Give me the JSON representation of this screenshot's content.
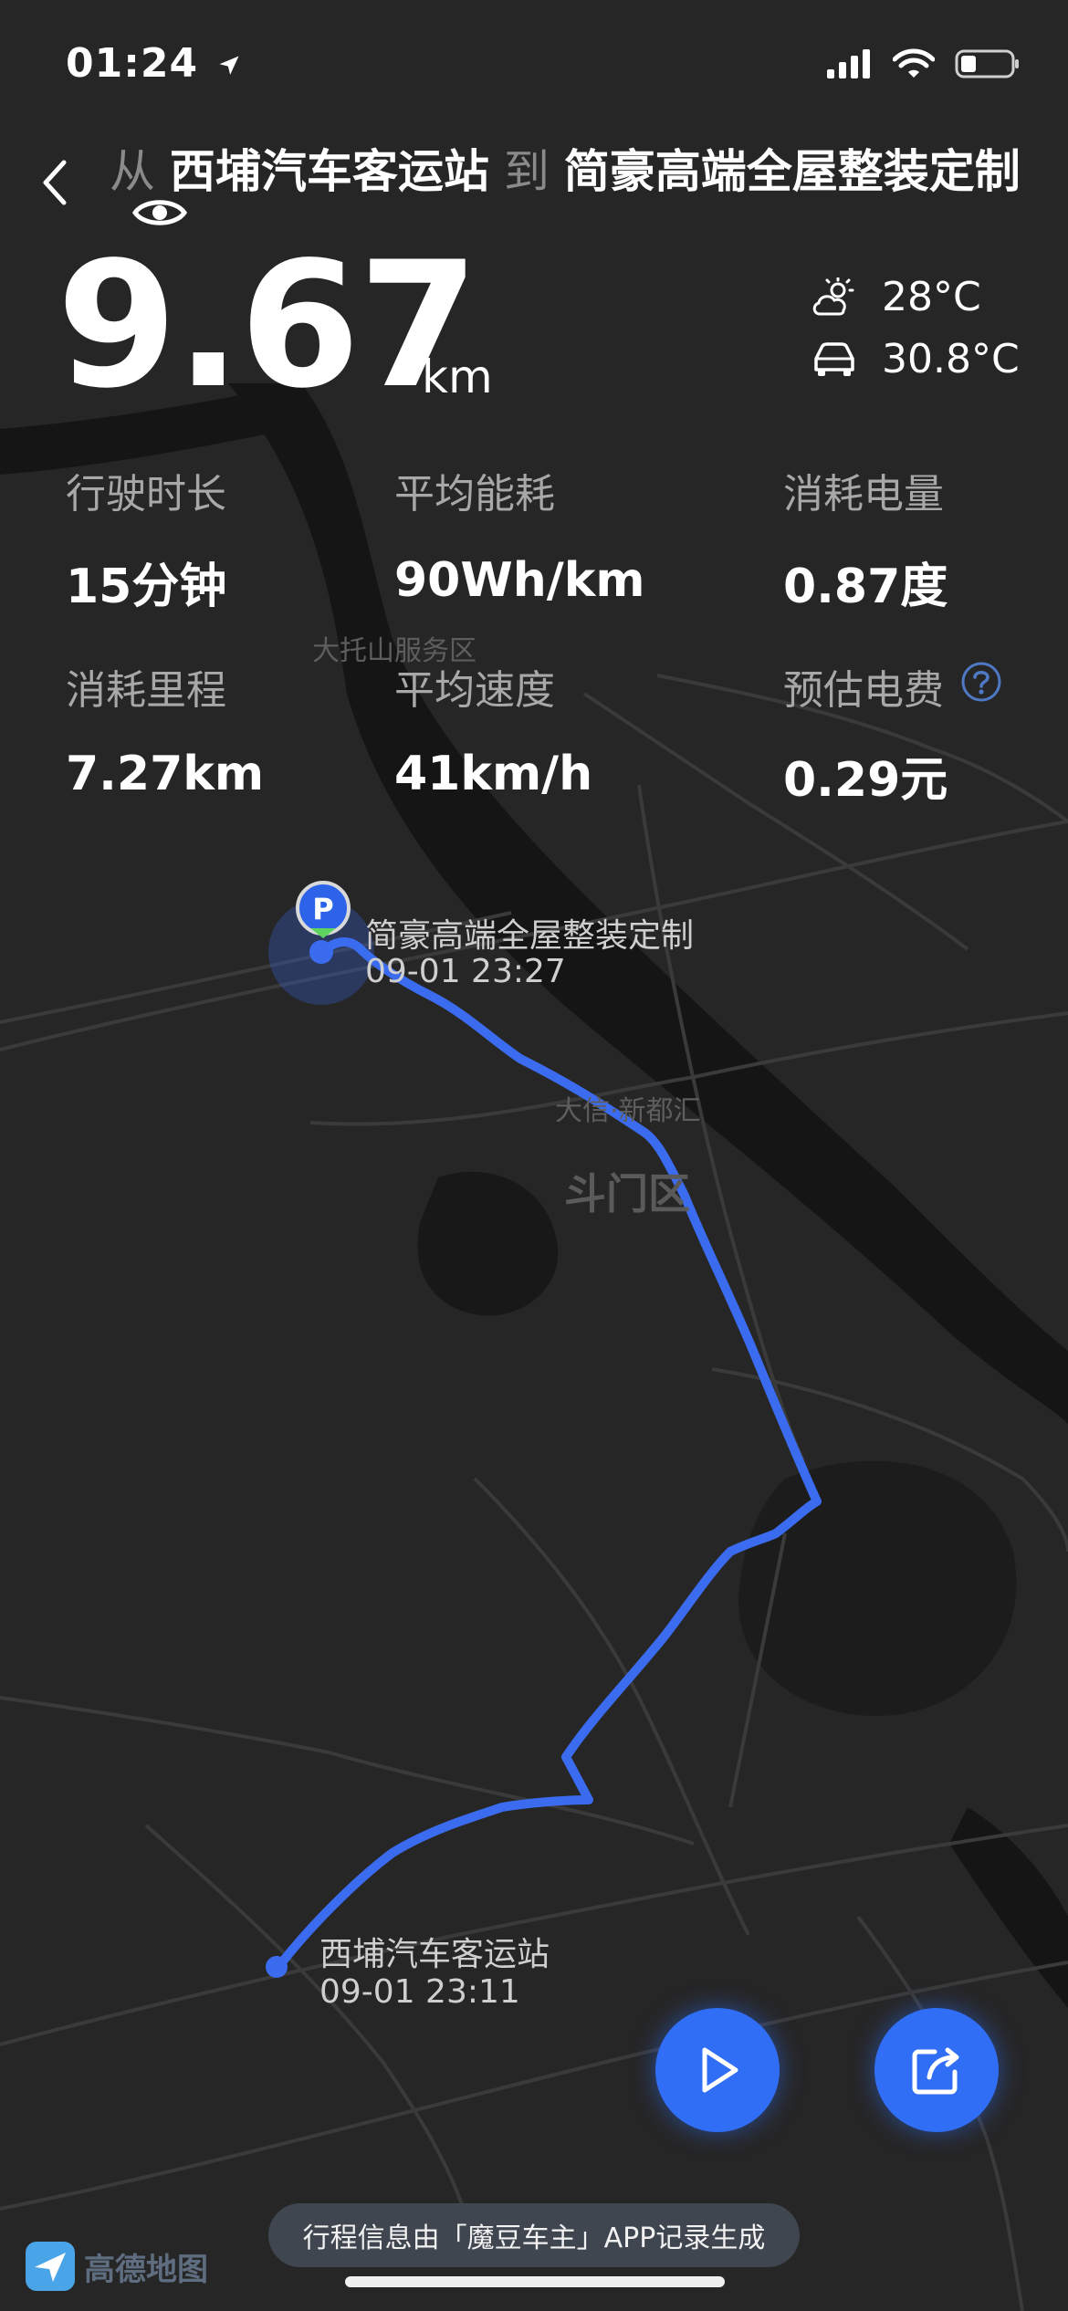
{
  "status_bar": {
    "time": "01:24"
  },
  "header": {
    "from_word": "从",
    "origin": "西埔汽车客运站",
    "to_word": "到",
    "destination": "简豪高端全屋整装定制"
  },
  "trip": {
    "distance": "9.67",
    "distance_unit": "km"
  },
  "weather": {
    "outside_temp": "28°C",
    "cabin_temp": "30.8°C"
  },
  "stats": [
    {
      "label": "行驶时长",
      "value": "15分钟"
    },
    {
      "label": "平均能耗",
      "value": "90Wh/km"
    },
    {
      "label": "消耗电量",
      "value": "0.87度"
    },
    {
      "label": "消耗里程",
      "value": "7.27km"
    },
    {
      "label": "平均速度",
      "value": "41km/h"
    },
    {
      "label": "预估电费",
      "value": "0.29元"
    }
  ],
  "map": {
    "labels": {
      "service_area": "大托山服务区",
      "poi": "大信·新都汇",
      "district": "斗门区"
    },
    "route_color": "#3b6cf0",
    "start": {
      "name": "西埔汽车客运站",
      "time": "09-01 23:11"
    },
    "end": {
      "name": "简豪高端全屋整装定制",
      "time": "09-01 23:27",
      "badge": "P"
    }
  },
  "footer": {
    "note": "行程信息由「魔豆车主」APP记录生成",
    "brand": "高德地图"
  }
}
